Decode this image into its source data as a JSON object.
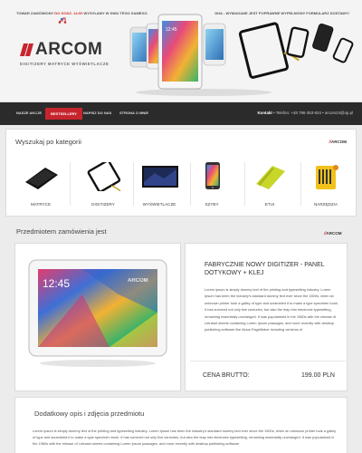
{
  "header": {
    "promo_left_pre": "TOWAR ZAMÓWIONY ",
    "promo_left_hl": "DO GODZ. 14:00",
    "promo_left_post": " WYSYŁAMY W DNIU TEGO SAMEGO",
    "promo_right": "DHA - WYMAGANE JEST POPRAWNE WYPEŁNIONY FORMULARZ DOSTAWY!",
    "logo_text": "ARCOM",
    "logo_tagline": "DIGITIZERY  MATRYCE  WYŚWIETLACZE",
    "hero_clock": "12:45"
  },
  "nav": {
    "items": [
      {
        "label": "Nasze Akcje"
      },
      {
        "label": "Bestsellery",
        "active": true
      },
      {
        "label": "Napisz do nas"
      },
      {
        "label": "Strona o mnie"
      }
    ],
    "contact_label": "Kontakt",
    "phone": "Telefon: +48 796-363-934",
    "email": "arcom24@op.pl"
  },
  "categories": {
    "title": "Wyszukaj po kategorii",
    "logo": "ARCOM",
    "items": [
      {
        "label": "MATRYCE",
        "icon": "matrix-panel-icon"
      },
      {
        "label": "DIGITIZERY",
        "icon": "digitizer-icon"
      },
      {
        "label": "WYŚWIETLACZE",
        "icon": "display-icon"
      },
      {
        "label": "SZYBY",
        "icon": "phone-glass-icon"
      },
      {
        "label": "ETUI",
        "icon": "case-icon"
      },
      {
        "label": "NARZĘDZIA",
        "icon": "tools-icon"
      }
    ]
  },
  "product": {
    "section_title": "Przedmiotem zamówienia jest",
    "logo": "ARCOM",
    "image_clock": "12:45",
    "image_watermark": "ARCOM",
    "name": "FABRYCZNIE NOWY DIGITIZER - PANEL DOTYKOWY + KLEJ",
    "description": "Lorem ipsum is simply dummy text of the printing and typesetting industry. Lorem Ipsum has been the industry's standard dummy text ever since the 1500s, when an unknown printer took a galley of type and scrambled it to make a type specimen book. It has survived not only five centuries, but also the leap into electronic typesetting, remaining essentially unchanged. It was popularised in the 1960s with the release of Letraset sheets containing Lorem Ipsum passages, and more recently with desktop publishing software like Aldus PageMaker including versions of",
    "price_label": "CENA BRUTTO:",
    "price_value": "199.00 PLN"
  },
  "details": {
    "title": "Dodatkowy opis i zdjęcia przedmiotu",
    "text": "Lorem Ipsum is simply dummy text of the printing and typesetting industry. Lorem Ipsum has been the industry's standard dummy text ever since the 1500s, when an unknown printer took a galley of type and scrambled it to make a type specimen book. It has survived not only five centuries, but also the leap into electronic typesetting, remaining essentially unchanged. It was popularised in the 1960s with the release of Letraset sheets containing Lorem Ipsum passages, and more recently with desktop publishing software"
  },
  "colors": {
    "accent": "#c7252d",
    "nav_bg": "#2b2b2b",
    "page_bg": "#ececec"
  }
}
